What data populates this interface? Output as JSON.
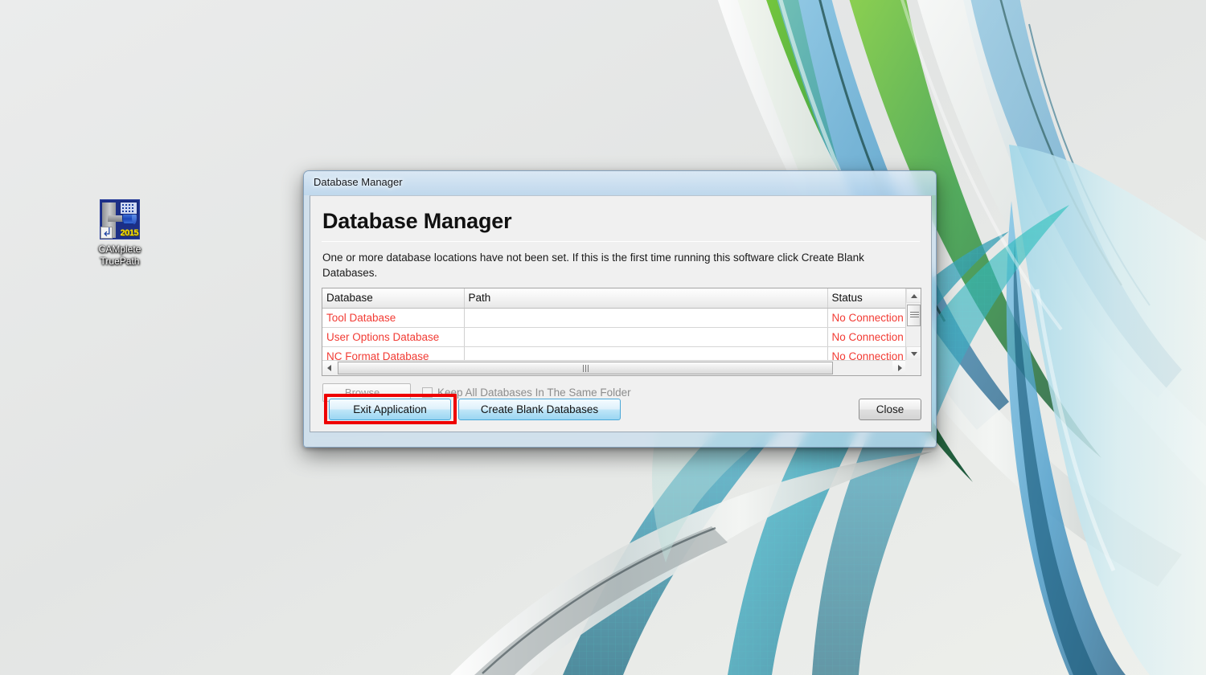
{
  "desktop": {
    "icon": {
      "name": "CAMplete TruePath",
      "label_line1": "CAMplete",
      "label_line2": "TruePath",
      "year_badge": "2015"
    }
  },
  "window": {
    "title": "Database Manager",
    "heading": "Database Manager",
    "intro": "One or more database locations have not been set. If this is the first time running this software click Create Blank Databases.",
    "table": {
      "columns": [
        "Database",
        "Path",
        "Status"
      ],
      "rows": [
        {
          "database": "Tool Database",
          "path": "",
          "status": "No Connection"
        },
        {
          "database": "User Options Database",
          "path": "",
          "status": "No Connection"
        },
        {
          "database": "NC Format Database",
          "path": "",
          "status": "No Connection"
        }
      ]
    },
    "browse_button": "Browse...",
    "keep_checkbox_label": "Keep All Databases In The Same Folder",
    "buttons": {
      "exit": "Exit Application",
      "create": "Create Blank Databases",
      "close": "Close"
    }
  },
  "colors": {
    "status_error": "#f23b34",
    "accent_button": "#9ad6f2",
    "highlight_box": "#ee0000",
    "window_frame": "#c4dbef"
  }
}
